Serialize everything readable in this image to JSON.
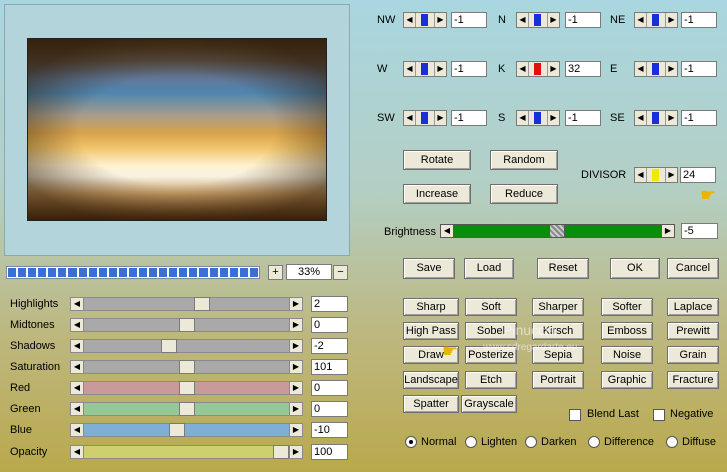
{
  "zoom": {
    "minus": "−",
    "plus": "+",
    "value": "33%"
  },
  "progress": {
    "segments": 25
  },
  "sliders": [
    {
      "label": "Highlights",
      "value": "2",
      "level": 0.58,
      "color": "#a9a9a9"
    },
    {
      "label": "Midtones",
      "value": "0",
      "level": 0.5,
      "color": "#a9a9a9"
    },
    {
      "label": "Shadows",
      "value": "-2",
      "level": 0.41,
      "color": "#a9a9a9"
    },
    {
      "label": "Saturation",
      "value": "101",
      "level": 0.5,
      "color": "#a9a9a9"
    },
    {
      "label": "Red",
      "value": "0",
      "level": 0.5,
      "color": "#c99a9a"
    },
    {
      "label": "Green",
      "value": "0",
      "level": 0.5,
      "color": "#96c896"
    },
    {
      "label": "Blue",
      "value": "-10",
      "level": 0.45,
      "color": "#7faed6"
    },
    {
      "label": "Opacity",
      "value": "100",
      "level": 1.0,
      "color": "#cfcf6e"
    }
  ],
  "matrix": [
    {
      "label": "NW",
      "value": "-1",
      "color": "#1a2fd8"
    },
    {
      "label": "N",
      "value": "-1",
      "color": "#1a2fd8"
    },
    {
      "label": "NE",
      "value": "-1",
      "color": "#1a2fd8"
    },
    {
      "label": "W",
      "value": "-1",
      "color": "#1a2fd8"
    },
    {
      "label": "K",
      "value": "32",
      "color": "#e01010"
    },
    {
      "label": "E",
      "value": "-1",
      "color": "#1a2fd8"
    },
    {
      "label": "SW",
      "value": "-1",
      "color": "#1a2fd8"
    },
    {
      "label": "S",
      "value": "-1",
      "color": "#1a2fd8"
    },
    {
      "label": "SE",
      "value": "-1",
      "color": "#1a2fd8"
    }
  ],
  "actions": {
    "rotate": "Rotate",
    "random": "Random",
    "increase": "Increase",
    "reduce": "Reduce"
  },
  "divisor": {
    "label": "DIVISOR",
    "value": "24",
    "color": "#f2e800"
  },
  "brightness": {
    "label": "Brightness",
    "value": "-5"
  },
  "file_buttons": {
    "save": "Save",
    "load": "Load",
    "reset": "Reset",
    "ok": "OK",
    "cancel": "Cancel"
  },
  "filters": [
    "Sharp",
    "Soft",
    "Sharper",
    "Softer",
    "Laplace",
    "High Pass",
    "Sobel",
    "Kirsch",
    "Emboss",
    "Prewitt",
    "Draw",
    "Posterize",
    "Sepia",
    "Noise",
    "Grain",
    "Landscape",
    "Etch",
    "Portrait",
    "Graphic",
    "Fracture",
    "Spatter",
    "Grayscale"
  ],
  "options": {
    "blend_last": "Blend Last",
    "negative": "Negative"
  },
  "modes": [
    {
      "label": "Normal",
      "selected": true
    },
    {
      "label": "Lighten",
      "selected": false
    },
    {
      "label": "Darken",
      "selected": false
    },
    {
      "label": "Difference",
      "selected": false
    },
    {
      "label": "Diffuse",
      "selected": false
    }
  ],
  "watermark": {
    "line1": "Pinuccia",
    "line2": "www.sdregardarte.eu"
  }
}
